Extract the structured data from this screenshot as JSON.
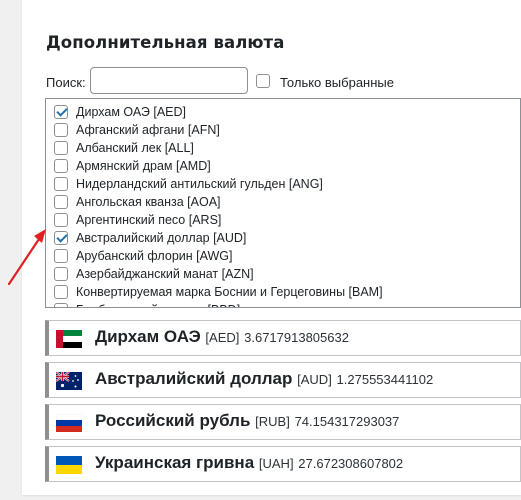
{
  "section": {
    "title": "Дополнительная валюта"
  },
  "search": {
    "label": "Поиск:",
    "value": "",
    "placeholder": ""
  },
  "only_selected": {
    "label": "Только выбранные",
    "checked": false
  },
  "currency_list": [
    {
      "label": "Дирхам ОАЭ [AED]",
      "checked": true
    },
    {
      "label": "Афганский афгани [AFN]",
      "checked": false
    },
    {
      "label": "Албанский лек [ALL]",
      "checked": false
    },
    {
      "label": "Армянский драм [AMD]",
      "checked": false
    },
    {
      "label": "Нидерландский антильский гульден [ANG]",
      "checked": false
    },
    {
      "label": "Ангольская кванза [AOA]",
      "checked": false
    },
    {
      "label": "Аргентинский песо [ARS]",
      "checked": false
    },
    {
      "label": "Австралийский доллар [AUD]",
      "checked": true
    },
    {
      "label": "Арубанский флорин [AWG]",
      "checked": false
    },
    {
      "label": "Азербайджанский манат [AZN]",
      "checked": false
    },
    {
      "label": "Конвертируемая марка Боснии и Герцеговины [BAM]",
      "checked": false
    },
    {
      "label": "Барбадосский доллар [BBD]",
      "checked": false
    }
  ],
  "selected_panels": [
    {
      "name": "Дирхам ОАЭ",
      "code": "[AED]",
      "rate": "3.6717913805632",
      "flag": "uae-flag"
    },
    {
      "name": "Австралийский доллар",
      "code": "[AUD]",
      "rate": "1.275553441102",
      "flag": "australia-flag"
    },
    {
      "name": "Российский рубль",
      "code": "[RUB]",
      "rate": "74.154317293037",
      "flag": "russia-flag"
    },
    {
      "name": "Украинская гривна",
      "code": "[UAH]",
      "rate": "27.672308607802",
      "flag": "ukraine-flag"
    }
  ],
  "colors": {
    "annotation_arrow": "#e02020",
    "checkbox_check": "#2271b1"
  }
}
